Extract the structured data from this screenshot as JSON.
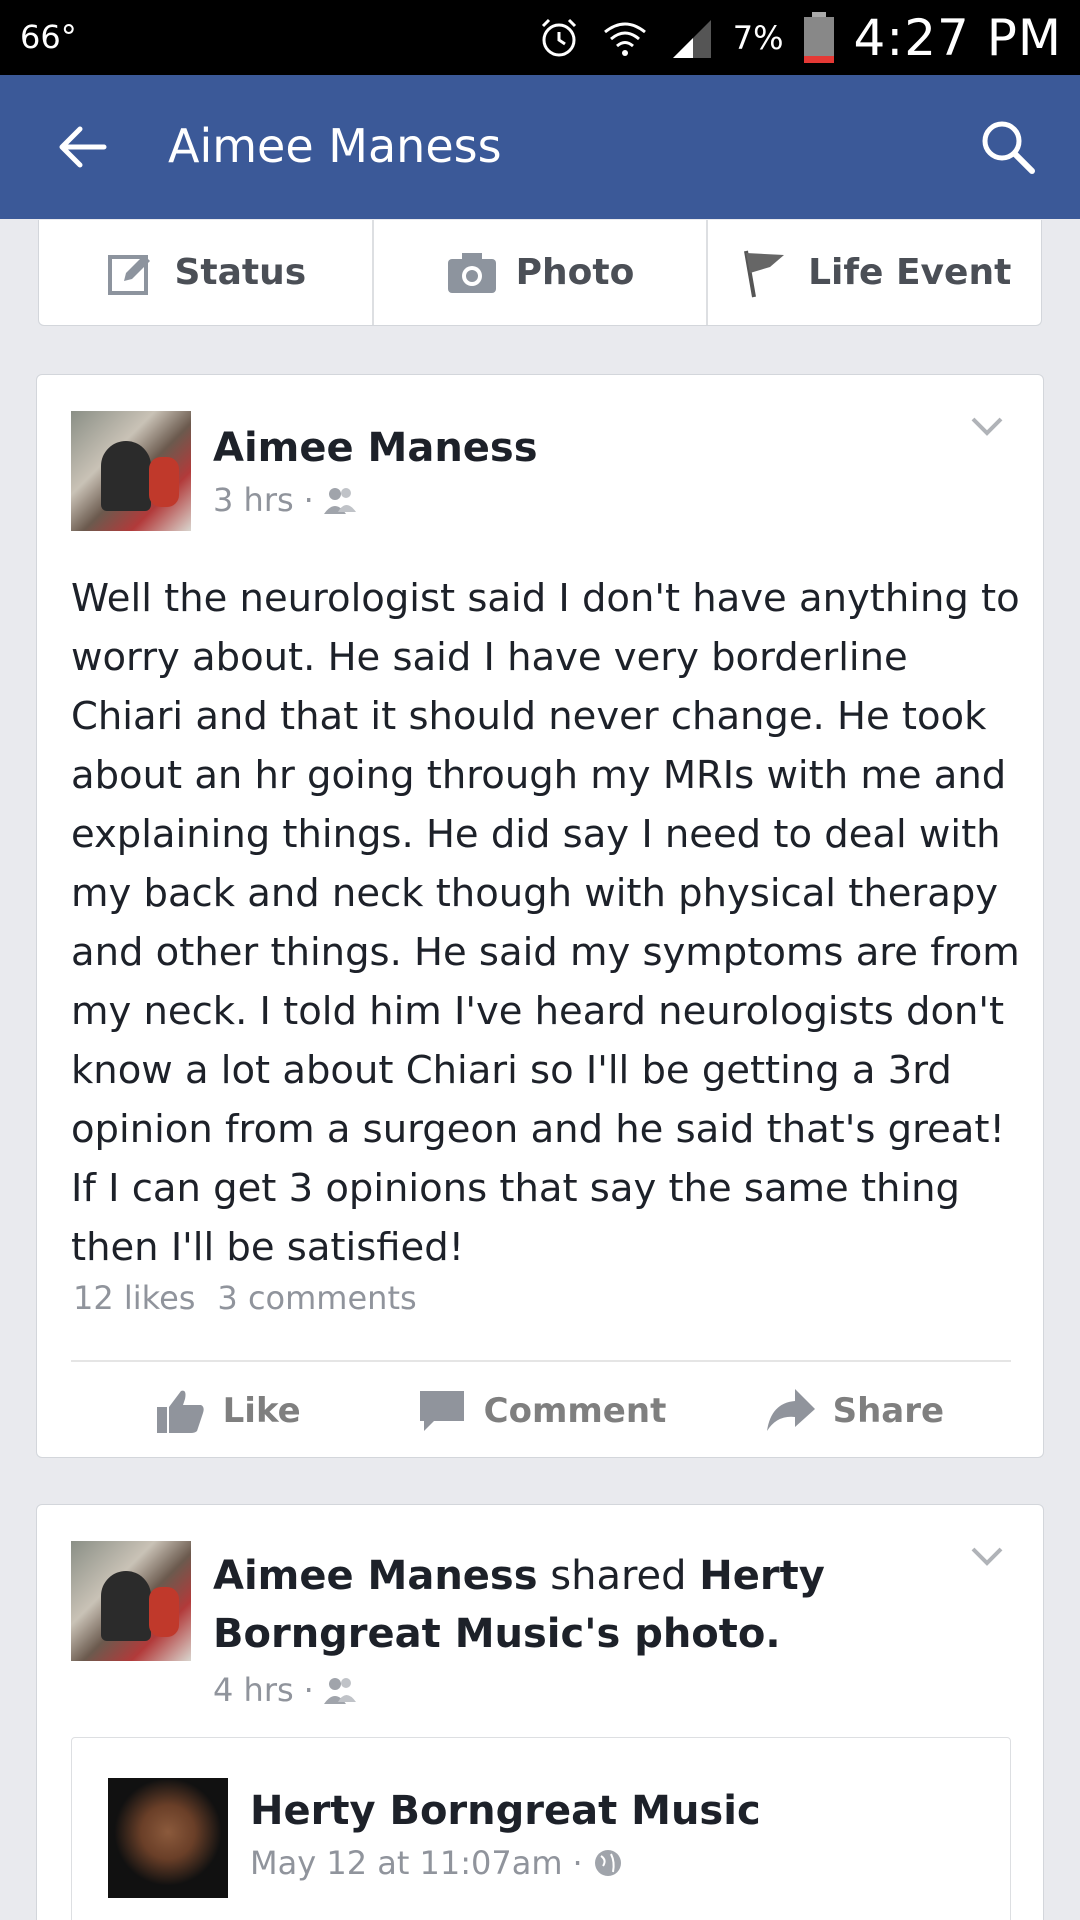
{
  "status_bar": {
    "temperature": "66°",
    "battery_percent": "7%",
    "time": "4:27 PM"
  },
  "header": {
    "title": "Aimee Maness",
    "back_icon": "arrow-left-icon",
    "search_icon": "search-icon"
  },
  "composer": {
    "items": [
      {
        "label": "Status",
        "icon": "edit-icon"
      },
      {
        "label": "Photo",
        "icon": "camera-icon"
      },
      {
        "label": "Life Event",
        "icon": "flag-icon"
      }
    ]
  },
  "posts": [
    {
      "author": "Aimee Maness",
      "time": "3 hrs",
      "privacy": "friends-icon",
      "text": "Well the neurologist said I don't have anything to worry about. He said I have very borderline Chiari and that it should never change. He took about an hr going through my MRIs with me and explaining things. He did say I need to deal with my back and neck though with physical therapy and other things. He said my symptoms are from my neck. I told him I've heard neurologists don't know a lot about Chiari so I'll be getting a 3rd opinion from a surgeon and he said that's great! If I can get 3 opinions that say the same thing then I'll be satisfied!",
      "likes": "12 likes",
      "comments": "3 comments",
      "actions": {
        "like": "Like",
        "comment": "Comment",
        "share": "Share"
      }
    },
    {
      "author": "Aimee Maness",
      "verb": "shared",
      "target": "Herty Borngreat Music's photo.",
      "time": "4 hrs",
      "privacy": "friends-icon",
      "shared_author": "Herty Borngreat Music",
      "shared_time": "May 12 at 11:07am",
      "shared_privacy": "globe-icon"
    }
  ],
  "colors": {
    "header_bg": "#3b5998",
    "feed_bg": "#e9eaee",
    "meta_text": "#90949c"
  }
}
